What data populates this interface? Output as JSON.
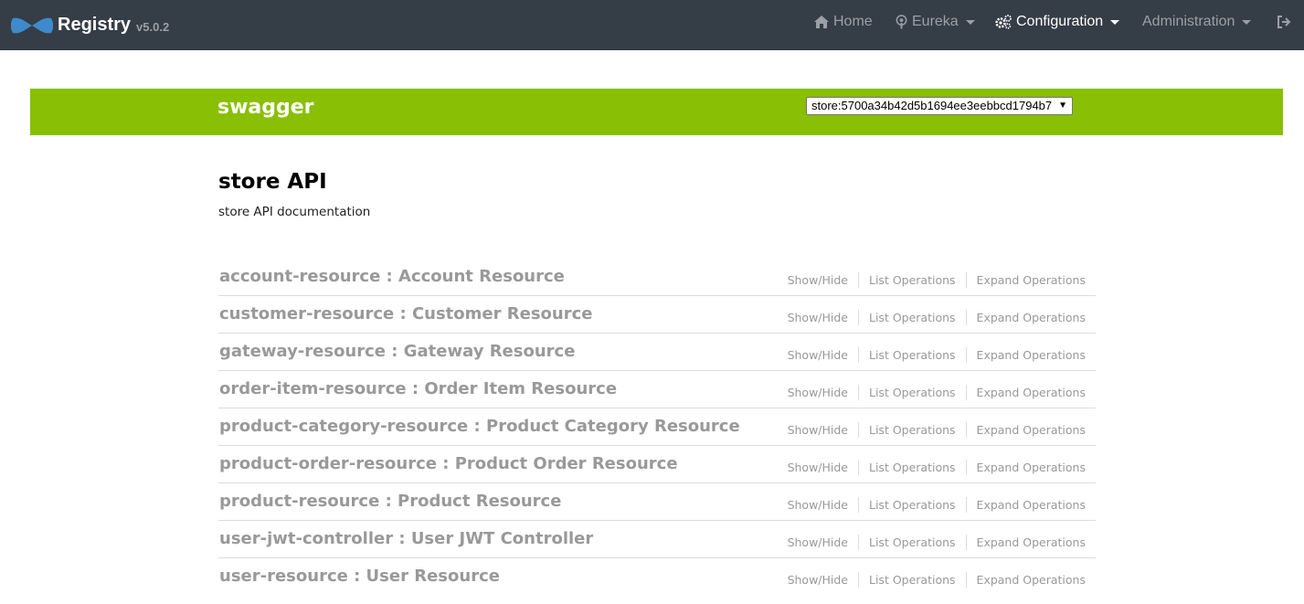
{
  "navbar": {
    "brand_name": "Registry",
    "brand_version": "v5.0.2",
    "items": [
      {
        "label": "Home",
        "icon": "home-icon"
      },
      {
        "label": "Eureka",
        "icon": "eureka-icon"
      },
      {
        "label": "Configuration",
        "icon": "cogs-icon"
      },
      {
        "label": "Administration",
        "icon": ""
      }
    ],
    "logout_icon": "sign-out-icon",
    "colors": {
      "background": "#353d47",
      "active": "#ffffff",
      "inactive": "#9aa0a6"
    }
  },
  "swagger": {
    "title": "swagger",
    "selected_api": "store:5700a34b42d5b1694ee3eebbcd1794b7",
    "color": "#89bf04"
  },
  "info": {
    "title": "store API",
    "description": "store API documentation"
  },
  "resource_actions": {
    "show_hide": "Show/Hide",
    "list_operations": "List Operations",
    "expand_operations": "Expand Operations"
  },
  "resources": [
    {
      "name": "account-resource : Account Resource"
    },
    {
      "name": "customer-resource : Customer Resource"
    },
    {
      "name": "gateway-resource : Gateway Resource"
    },
    {
      "name": "order-item-resource : Order Item Resource"
    },
    {
      "name": "product-category-resource : Product Category Resource"
    },
    {
      "name": "product-order-resource : Product Order Resource"
    },
    {
      "name": "product-resource : Product Resource"
    },
    {
      "name": "user-jwt-controller : User JWT Controller"
    },
    {
      "name": "user-resource : User Resource"
    }
  ]
}
